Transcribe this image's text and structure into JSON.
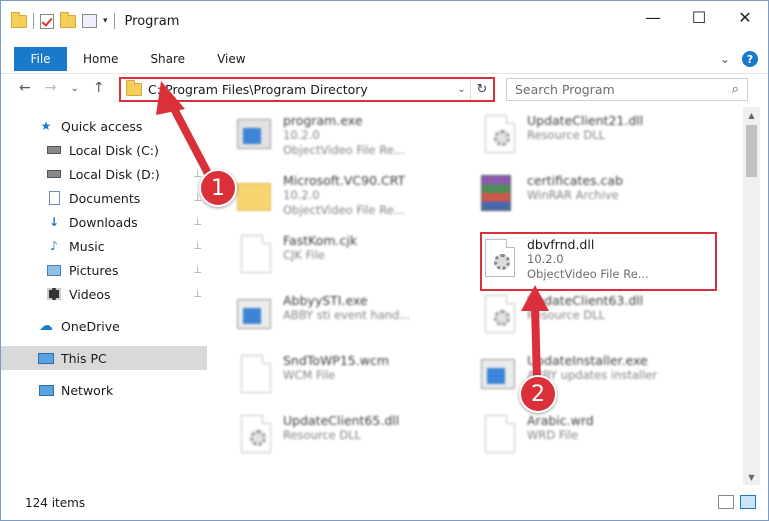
{
  "window": {
    "title": "Program",
    "controls": {
      "minimize": "—",
      "maximize": "☐",
      "close": "✕"
    }
  },
  "ribbon": {
    "tabs": [
      "File",
      "Home",
      "Share",
      "View"
    ],
    "expand_icon": "⌄",
    "help_label": "?"
  },
  "navbar": {
    "back": "←",
    "forward": "→",
    "recent": "⌄",
    "up": "↑",
    "address": "C:\\Program Files\\Program Directory",
    "address_dropdown": "⌄",
    "refresh": "↻",
    "search_placeholder": "Search Program",
    "search_icon": "⌕"
  },
  "sidebar": {
    "items": [
      {
        "label": "Quick access",
        "icon": "star-icon"
      },
      {
        "label": "Local Disk (C:)",
        "icon": "drive-icon"
      },
      {
        "label": "Local Disk (D:)",
        "icon": "drive-icon"
      },
      {
        "label": "Documents",
        "icon": "documents-icon"
      },
      {
        "label": "Downloads",
        "icon": "downloads-icon"
      },
      {
        "label": "Music",
        "icon": "music-icon"
      },
      {
        "label": "Pictures",
        "icon": "pictures-icon"
      },
      {
        "label": "Videos",
        "icon": "videos-icon"
      },
      {
        "label": "OneDrive",
        "icon": "cloud-icon"
      },
      {
        "label": "This PC",
        "icon": "computer-icon"
      },
      {
        "label": "Network",
        "icon": "network-icon"
      }
    ],
    "pin": "📌"
  },
  "files": [
    {
      "name": "program.exe",
      "line2": "10.2.0",
      "line3": "ObjectVideo File Re...",
      "icon": "installer"
    },
    {
      "name": "UpdateClient21.dll",
      "line2": "Resource DLL",
      "line3": "",
      "icon": "dll"
    },
    {
      "name": "Microsoft.VC90.CRT",
      "line2": "10.2.0",
      "line3": "ObjectVideo File Re...",
      "icon": "folder"
    },
    {
      "name": "certificates.cab",
      "line2": "WinRAR Archive",
      "line3": "",
      "icon": "rar"
    },
    {
      "name": "FastKom.cjk",
      "line2": "CJK File",
      "line3": "",
      "icon": "doc"
    },
    {
      "name": "dbvfrnd.dll",
      "line2": "10.2.0",
      "line3": "ObjectVideo File Re...",
      "icon": "dll"
    },
    {
      "name": "AbbyySTI.exe",
      "line2": "ABBY sti event hand...",
      "line3": "",
      "icon": "exe"
    },
    {
      "name": "UpdateClient63.dll",
      "line2": "Resource DLL",
      "line3": "",
      "icon": "dll"
    },
    {
      "name": "SndToWP15.wcm",
      "line2": "WCM File",
      "line3": "",
      "icon": "doc"
    },
    {
      "name": "UpdateInstaller.exe",
      "line2": "ABBY updates installer",
      "line3": "",
      "icon": "exe"
    },
    {
      "name": "UpdateClient65.dll",
      "line2": "Resource DLL",
      "line3": "",
      "icon": "dll"
    },
    {
      "name": "Arabic.wrd",
      "line2": "WRD File",
      "line3": "",
      "icon": "doc"
    }
  ],
  "status": {
    "count": "124 items"
  },
  "annotations": {
    "marker1": "1",
    "marker2": "2",
    "color": "#d9303a"
  }
}
